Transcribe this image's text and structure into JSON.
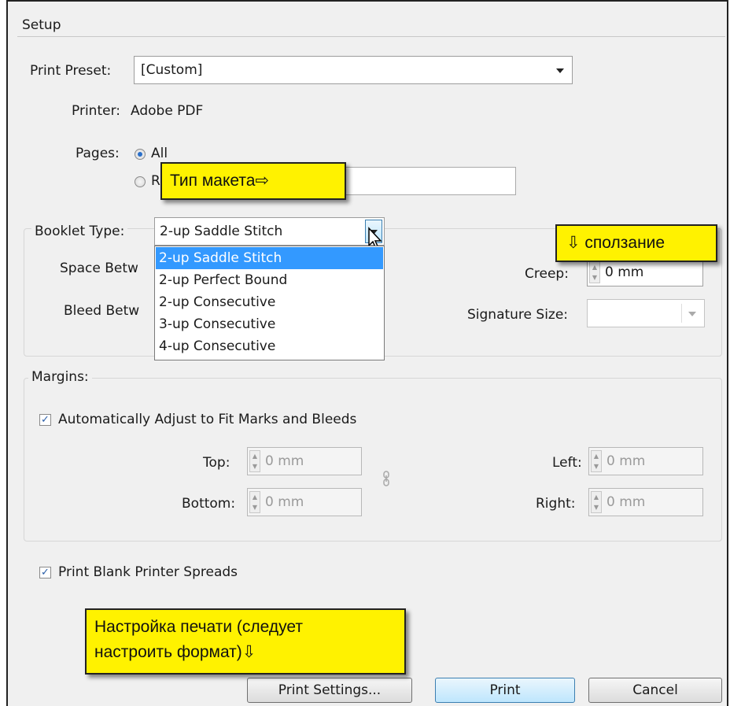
{
  "section": {
    "title": "Setup"
  },
  "print_preset": {
    "label": "Print Preset:",
    "value": "[Custom]"
  },
  "printer": {
    "label": "Printer:",
    "value": "Adobe PDF"
  },
  "pages": {
    "label": "Pages:",
    "all_label": "All",
    "range_partial": "R"
  },
  "booklet_type": {
    "label": "Booklet Type:",
    "value": "2-up Saddle Stitch",
    "options": [
      "2-up Saddle Stitch",
      "2-up Perfect Bound",
      "2-up Consecutive",
      "3-up Consecutive",
      "4-up Consecutive"
    ]
  },
  "space_between": {
    "label_partial": "Space Betw"
  },
  "bleed_between": {
    "label_partial": "Bleed Betw"
  },
  "creep": {
    "label": "Creep:",
    "value": "0 mm"
  },
  "signature_size": {
    "label": "Signature Size:",
    "value": ""
  },
  "margins": {
    "title": "Margins:",
    "auto_adjust_label": "Automatically Adjust to Fit Marks and Bleeds",
    "top_label": "Top:",
    "top_value": "0 mm",
    "bottom_label": "Bottom:",
    "bottom_value": "0 mm",
    "left_label": "Left:",
    "left_value": "0 mm",
    "right_label": "Right:",
    "right_value": "0 mm"
  },
  "print_blank": {
    "label": "Print Blank Printer Spreads"
  },
  "buttons": {
    "print_settings": "Print Settings...",
    "print": "Print",
    "cancel": "Cancel"
  },
  "annotations": {
    "layout_type": "Тип макета⇨",
    "creep": "⇩ сползание",
    "print_settings_line1": "Настройка печати (следует",
    "print_settings_line2": "настроить формат)⇩"
  },
  "colors": {
    "selection": "#3399ff",
    "callout": "#fff200",
    "default_button": "#bee6fd"
  }
}
